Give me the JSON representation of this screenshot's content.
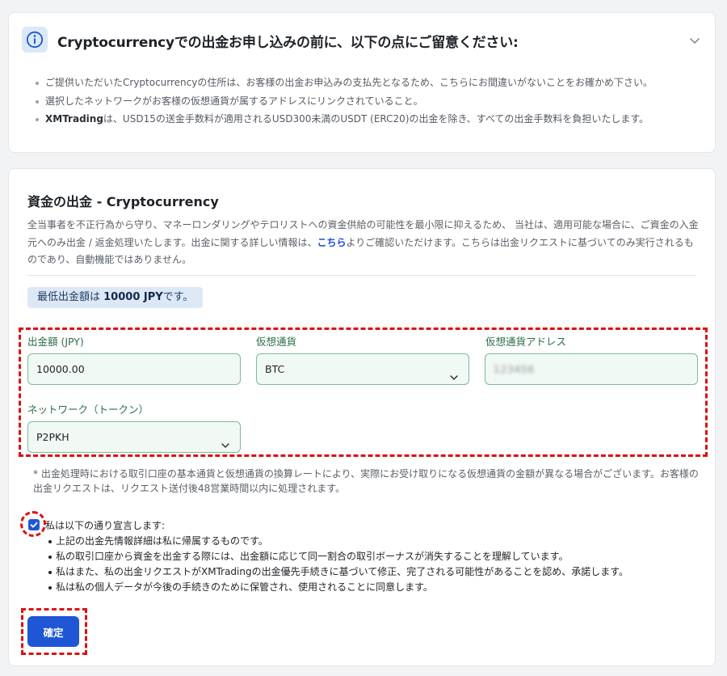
{
  "notice": {
    "title": "Cryptocurrencyでの出金お申し込みの前に、以下の点にご留意ください:",
    "items": [
      {
        "bold": "",
        "text": "ご提供いただいたCryptocurrencyの住所は、お客様の出金お申込みの支払先となるため、こちらにお間違いがないことをお確かめ下さい。"
      },
      {
        "bold": "",
        "text": "選択したネットワークがお客様の仮想通貨が属するアドレスにリンクされていること。"
      },
      {
        "bold": "XMTrading",
        "text": "は、USD15の送金手数料が適用されるUSD300未満のUSDT (ERC20)の出金を除き、すべての出金手数料を負担いたします。"
      }
    ]
  },
  "withdraw": {
    "title": "資金の出金 - Cryptocurrency",
    "desc_before": "全当事者を不正行為から守り、マネーロンダリングやテロリストへの資金供給の可能性を最小限に抑えるため、 当社は、適用可能な場合に、ご資金の入金元へのみ出金 / 返金処理いたします。出金に関する詳しい情報は、",
    "desc_link": "こちら",
    "desc_after": "よりご確認いただけます。こちらは出金リクエストに基づいてのみ実行されるものであり、自動機能ではありません。",
    "min_prefix": "最低出金額は ",
    "min_amount": "10000 JPY",
    "min_suffix": "です。",
    "fields": {
      "amount_label": "出金額 (JPY)",
      "amount_value": "10000.00",
      "currency_label": "仮想通貨",
      "currency_value": "BTC",
      "address_label": "仮想通貨アドレス",
      "address_value": "123456",
      "network_label": "ネットワーク（トークン）",
      "network_value": "P2PKH"
    },
    "footnote": "* 出金処理時における取引口座の基本通貨と仮想通貨の換算レートにより、実際にお受け取りになる仮想通貨の金額が異なる場合がございます。お客様の出金リクエストは、リクエスト送付後48営業時間以内に処理されます。",
    "declaration_title": "私は以下の通り宣言します:",
    "declarations": [
      "上記の出金先情報詳細は私に帰属するものです。",
      "私の取引口座から資金を出金する際には、出金額に応じて同一割合の取引ボーナスが消失することを理解しています。",
      "私はまた、私の出金リクエストがXMTradingの出金優先手続きに基づいて修正、完了される可能性があることを認め、承諾します。",
      "私は私の個人データが今後の手続きのために保管され、使用されることに同意します。"
    ],
    "declaration_checked": true,
    "confirm_label": "確定"
  },
  "colors": {
    "accent": "#1e56d6",
    "field_border": "#7db89b",
    "field_bg": "#f1f9f5",
    "label_green": "#2c6e49",
    "highlight_red": "#dd1111",
    "info_bg": "#dde8f7"
  },
  "icons": {
    "notice_icon": "info-circle-icon",
    "collapse_icon": "chevron-down-icon",
    "select_icon": "chevron-down-icon",
    "checkbox_icon": "checkmark-icon"
  }
}
